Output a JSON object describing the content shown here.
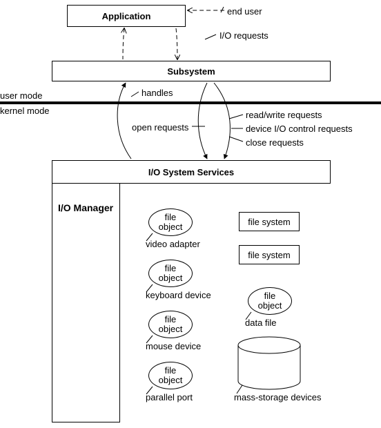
{
  "boxes": {
    "application": "Application",
    "subsystem": "Subsystem",
    "io_services": "I/O System Services",
    "io_manager": "I/O Manager",
    "file_system": "file system"
  },
  "mode": {
    "user": "user mode",
    "kernel": "kernel mode"
  },
  "annotations": {
    "end_user": "end user",
    "io_requests": "I/O requests",
    "handles": "handles",
    "open_requests": "open requests",
    "read_write": "read/write requests",
    "device_io": "device I/O control requests",
    "close": "close requests"
  },
  "file_objects": {
    "label": "file\nobject",
    "video": "video adapter",
    "keyboard": "keyboard device",
    "mouse": "mouse device",
    "parallel": "parallel port",
    "data_file": "data file",
    "mass_storage": "mass-storage devices"
  }
}
